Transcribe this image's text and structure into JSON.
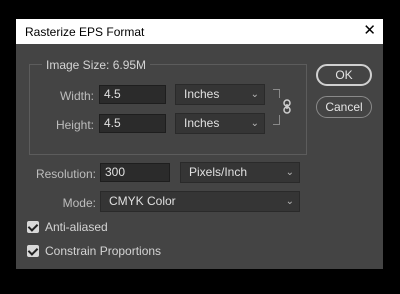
{
  "dialog": {
    "title": "Rasterize EPS Format",
    "close_glyph": "✕"
  },
  "image_size": {
    "label": "Image Size: 6.95M",
    "width_label": "Width:",
    "width_value": "4.5",
    "width_unit": "Inches",
    "height_label": "Height:",
    "height_value": "4.5",
    "height_unit": "Inches"
  },
  "resolution": {
    "label": "Resolution:",
    "value": "300",
    "unit": "Pixels/Inch"
  },
  "mode": {
    "label": "Mode:",
    "value": "CMYK Color"
  },
  "options": {
    "anti_aliased": "Anti-aliased",
    "constrain": "Constrain Proportions"
  },
  "buttons": {
    "ok": "OK",
    "cancel": "Cancel"
  },
  "icons": {
    "chevron": "⌄",
    "link": "link-icon"
  }
}
